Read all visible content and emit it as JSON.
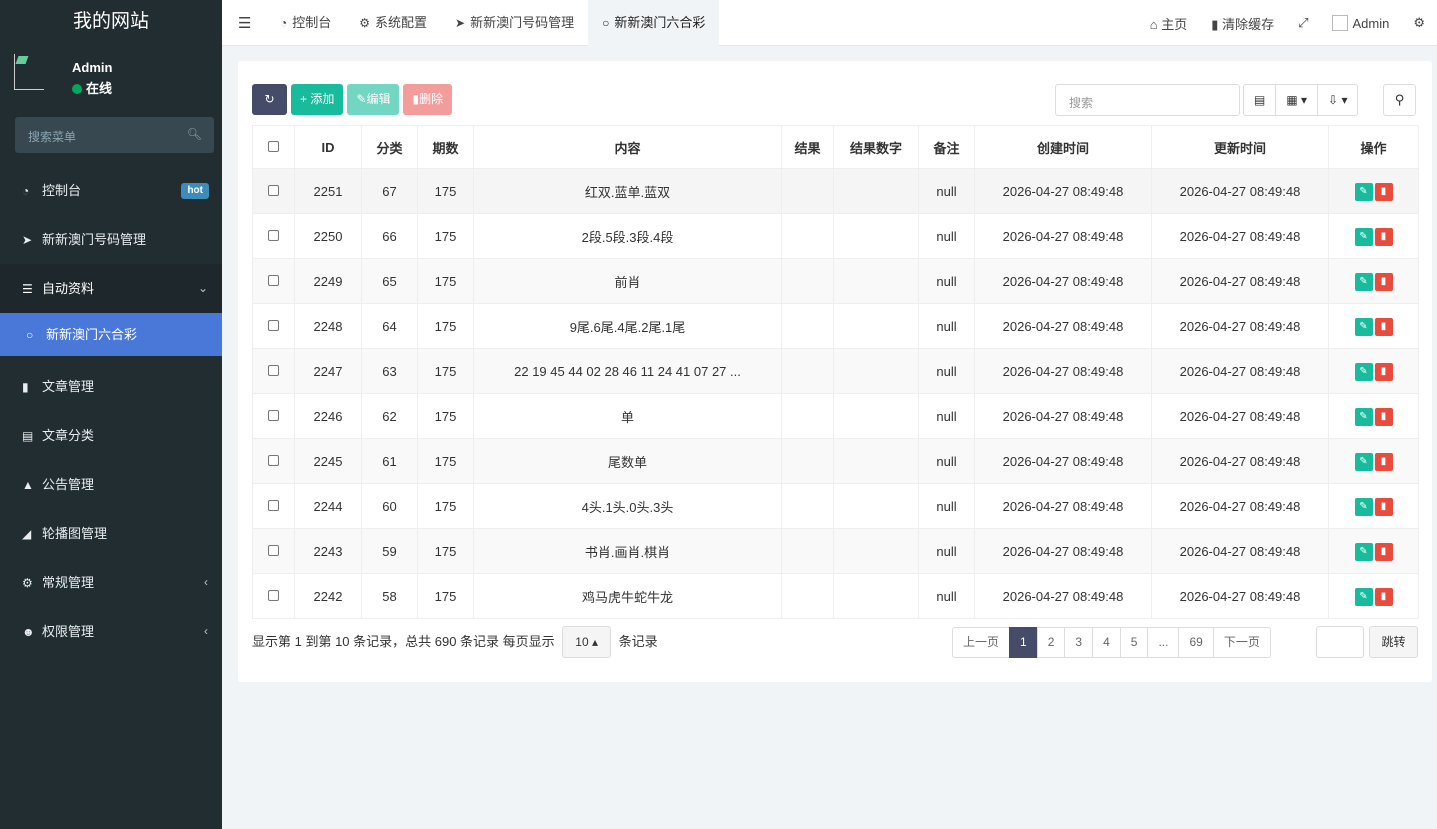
{
  "sidebar": {
    "logo": "我的网站",
    "user": {
      "name": "Admin",
      "status": "在线"
    },
    "search_placeholder": "搜索菜单",
    "items": [
      {
        "label": "控制台",
        "icon": "dashboard-icon",
        "badge": "hot"
      },
      {
        "label": "新新澳门号码管理",
        "icon": "location-arrow-icon"
      },
      {
        "label": "自动资料",
        "icon": "list-icon"
      },
      {
        "label": "新新澳门六合彩",
        "icon": "circle-icon"
      },
      {
        "label": "文章管理",
        "icon": "bookmark-icon"
      },
      {
        "label": "文章分类",
        "icon": "list-alt-icon"
      },
      {
        "label": "公告管理",
        "icon": "bell-icon"
      },
      {
        "label": "轮播图管理",
        "icon": "leaf-icon"
      },
      {
        "label": "常规管理",
        "icon": "cogs-icon"
      },
      {
        "label": "权限管理",
        "icon": "group-icon"
      }
    ]
  },
  "topbar": {
    "tabs": [
      {
        "label": "控制台",
        "icon": "dashboard-icon"
      },
      {
        "label": "系统配置",
        "icon": "gear-icon"
      },
      {
        "label": "新新澳门号码管理",
        "icon": "location-arrow-icon"
      },
      {
        "label": "新新澳门六合彩",
        "icon": "circle-icon"
      }
    ],
    "home": "主页",
    "clear_cache": "清除缓存",
    "user": "Admin"
  },
  "toolbar": {
    "add": "添加",
    "edit": "编辑",
    "delete": "删除",
    "search_placeholder": "搜索"
  },
  "table": {
    "headers": [
      "ID",
      "分类",
      "期数",
      "内容",
      "结果",
      "结果数字",
      "备注",
      "创建时间",
      "更新时间",
      "操作"
    ],
    "rows": [
      {
        "id": "2251",
        "cat": "67",
        "period": "175",
        "content": "红双.蓝单.蓝双",
        "result": "",
        "result_num": "",
        "note": "null",
        "created": "2026-04-27 08:49:48",
        "updated": "2026-04-27 08:49:48"
      },
      {
        "id": "2250",
        "cat": "66",
        "period": "175",
        "content": "2段.5段.3段.4段",
        "result": "",
        "result_num": "",
        "note": "null",
        "created": "2026-04-27 08:49:48",
        "updated": "2026-04-27 08:49:48"
      },
      {
        "id": "2249",
        "cat": "65",
        "period": "175",
        "content": "前肖",
        "result": "",
        "result_num": "",
        "note": "null",
        "created": "2026-04-27 08:49:48",
        "updated": "2026-04-27 08:49:48"
      },
      {
        "id": "2248",
        "cat": "64",
        "period": "175",
        "content": "9尾.6尾.4尾.2尾.1尾",
        "result": "",
        "result_num": "",
        "note": "null",
        "created": "2026-04-27 08:49:48",
        "updated": "2026-04-27 08:49:48"
      },
      {
        "id": "2247",
        "cat": "63",
        "period": "175",
        "content": "22 19 45 44 02 28 46 11 24 41 07 27 ...",
        "result": "",
        "result_num": "",
        "note": "null",
        "created": "2026-04-27 08:49:48",
        "updated": "2026-04-27 08:49:48"
      },
      {
        "id": "2246",
        "cat": "62",
        "period": "175",
        "content": "单",
        "result": "",
        "result_num": "",
        "note": "null",
        "created": "2026-04-27 08:49:48",
        "updated": "2026-04-27 08:49:48"
      },
      {
        "id": "2245",
        "cat": "61",
        "period": "175",
        "content": "尾数单",
        "result": "",
        "result_num": "",
        "note": "null",
        "created": "2026-04-27 08:49:48",
        "updated": "2026-04-27 08:49:48"
      },
      {
        "id": "2244",
        "cat": "60",
        "period": "175",
        "content": "4头.1头.0头.3头",
        "result": "",
        "result_num": "",
        "note": "null",
        "created": "2026-04-27 08:49:48",
        "updated": "2026-04-27 08:49:48"
      },
      {
        "id": "2243",
        "cat": "59",
        "period": "175",
        "content": "书肖.画肖.棋肖",
        "result": "",
        "result_num": "",
        "note": "null",
        "created": "2026-04-27 08:49:48",
        "updated": "2026-04-27 08:49:48"
      },
      {
        "id": "2242",
        "cat": "58",
        "period": "175",
        "content": "鸡马虎牛蛇牛龙",
        "result": "",
        "result_num": "",
        "note": "null",
        "created": "2026-04-27 08:49:48",
        "updated": "2026-04-27 08:49:48"
      }
    ]
  },
  "footer": {
    "info_prefix": "显示第 1 到第 10 条记录，总共 690 条记录 每页显示",
    "page_size": "10",
    "info_suffix": "条记录",
    "prev": "上一页",
    "pages": [
      "1",
      "2",
      "3",
      "4",
      "5",
      "...",
      "69"
    ],
    "active_page": "1",
    "next": "下一页",
    "jump": "跳转"
  },
  "colors": {
    "sidebar_bg": "#222d32",
    "active_menu": "#4a78d9",
    "primary_dark": "#444c69",
    "success": "#18bc9c",
    "danger": "#e74c3c",
    "hot_badge": "#3c8dbc"
  }
}
